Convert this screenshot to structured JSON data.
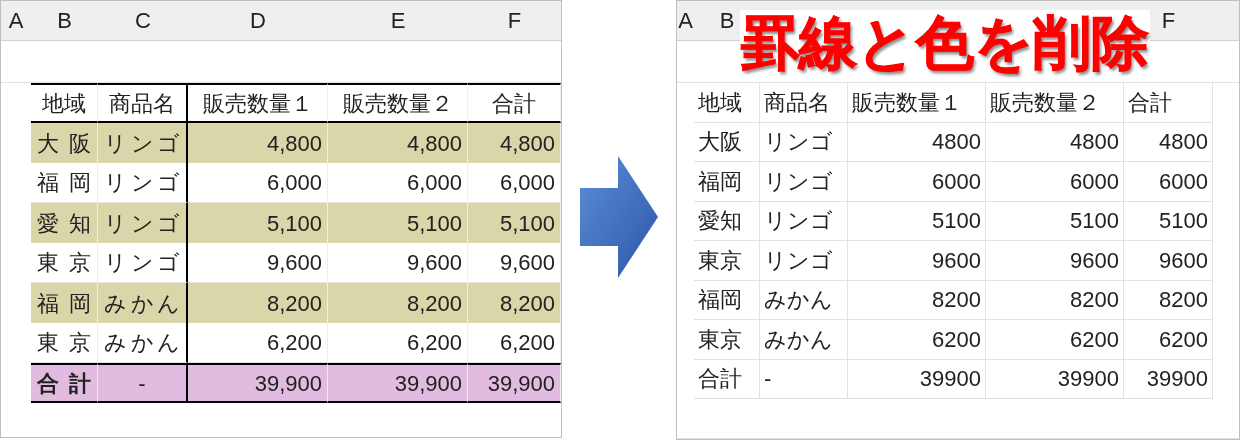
{
  "left_sheet": {
    "column_headers": [
      {
        "label": "A"
      },
      {
        "label": "B"
      },
      {
        "label": "C"
      },
      {
        "label": "D"
      },
      {
        "label": "E"
      },
      {
        "label": "F"
      }
    ],
    "rows": [
      {
        "kind": "header",
        "cells": [
          "地域",
          "商品名",
          "販売数量１",
          "販売数量２",
          "合計"
        ]
      },
      {
        "kind": "shaded",
        "cells": [
          "大阪",
          "リンゴ",
          "4,800",
          "4,800",
          "4,800"
        ]
      },
      {
        "kind": "plain",
        "cells": [
          "福岡",
          "リンゴ",
          "6,000",
          "6,000",
          "6,000"
        ]
      },
      {
        "kind": "shaded",
        "cells": [
          "愛知",
          "リンゴ",
          "5,100",
          "5,100",
          "5,100"
        ]
      },
      {
        "kind": "plain",
        "cells": [
          "東京",
          "リンゴ",
          "9,600",
          "9,600",
          "9,600"
        ]
      },
      {
        "kind": "shaded",
        "cells": [
          "福岡",
          "みかん",
          "8,200",
          "8,200",
          "8,200"
        ]
      },
      {
        "kind": "plain",
        "cells": [
          "東京",
          "みかん",
          "6,200",
          "6,200",
          "6,200"
        ]
      },
      {
        "kind": "total",
        "cells": [
          "合計",
          "-",
          "39,900",
          "39,900",
          "39,900"
        ]
      }
    ]
  },
  "title_banner": {
    "text": "罫線と色を削除"
  },
  "right_sheet": {
    "column_headers": [
      {
        "label": "A"
      },
      {
        "label": "B"
      },
      {
        "label": "F"
      }
    ],
    "rows": [
      {
        "kind": "header",
        "cells": [
          "地域",
          "商品名",
          "販売数量１",
          "販売数量２",
          "合計"
        ]
      },
      {
        "kind": "plain",
        "cells": [
          "大阪",
          "リンゴ",
          "4800",
          "4800",
          "4800"
        ]
      },
      {
        "kind": "plain",
        "cells": [
          "福岡",
          "リンゴ",
          "6000",
          "6000",
          "6000"
        ]
      },
      {
        "kind": "plain",
        "cells": [
          "愛知",
          "リンゴ",
          "5100",
          "5100",
          "5100"
        ]
      },
      {
        "kind": "plain",
        "cells": [
          "東京",
          "リンゴ",
          "9600",
          "9600",
          "9600"
        ]
      },
      {
        "kind": "plain",
        "cells": [
          "福岡",
          "みかん",
          "8200",
          "8200",
          "8200"
        ]
      },
      {
        "kind": "plain",
        "cells": [
          "東京",
          "みかん",
          "6200",
          "6200",
          "6200"
        ]
      },
      {
        "kind": "plain",
        "cells": [
          "合計",
          "-",
          "39900",
          "39900",
          "39900"
        ]
      }
    ]
  }
}
